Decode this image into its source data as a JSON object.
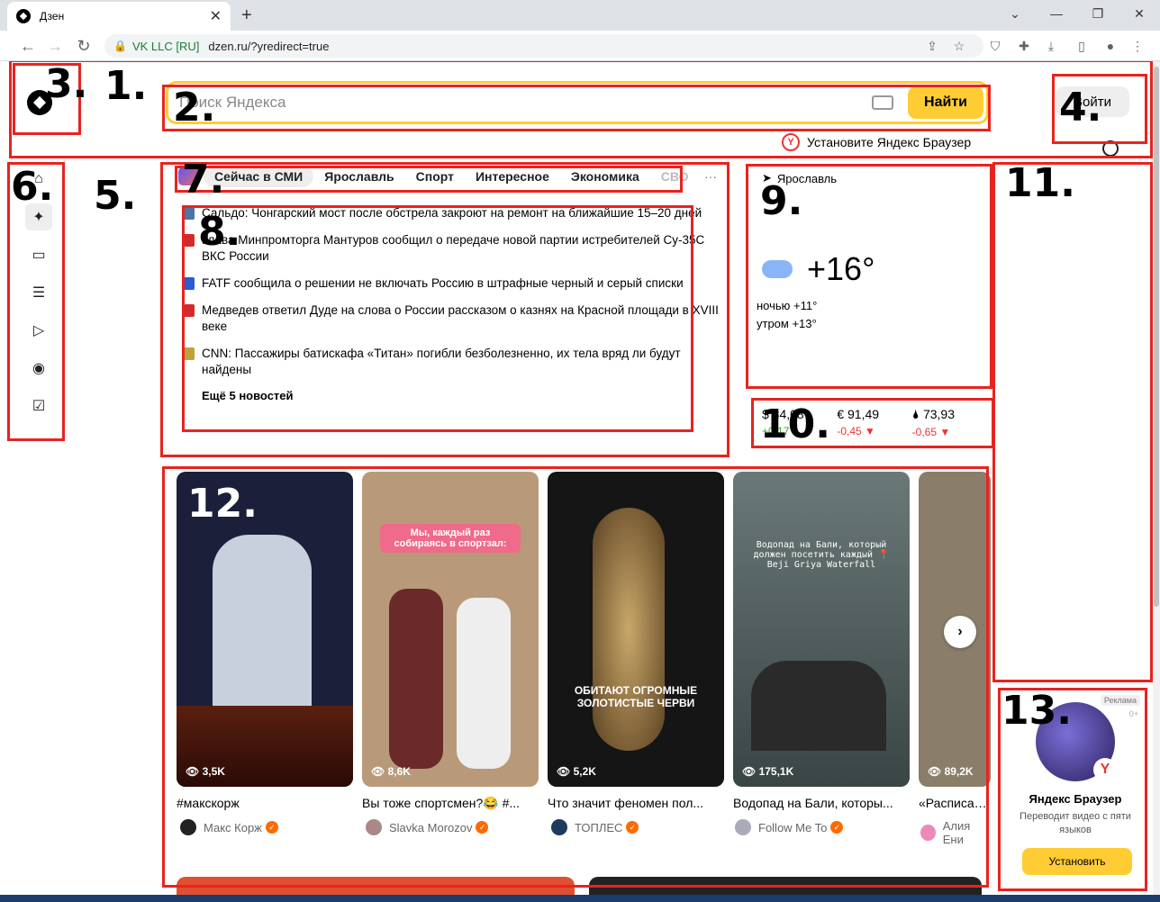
{
  "browser": {
    "tab_title": "Дзен",
    "new_tab": "+",
    "tab_close": "✕",
    "org": "VK LLC [RU]",
    "url": "dzen.ru/?yredirect=true"
  },
  "header": {
    "search_placeholder": "Поиск Яндекса",
    "find_label": "Найти",
    "login_label": "Войти",
    "promo_text": "Установите Яндекс Браузер"
  },
  "news": {
    "tabs": [
      "Сейчас в СМИ",
      "Ярославль",
      "Спорт",
      "Интересное",
      "Экономика",
      "СВО"
    ],
    "items": [
      {
        "text": "Сальдо: Чонгарский мост после обстрела закроют на ремонт на ближайшие 15–20 дней",
        "src_color": "#4a76a8"
      },
      {
        "text": "Глава Минпромторга Мантуров сообщил о передаче новой партии истребителей Су-35С ВКС России",
        "src_color": "#d42a2a"
      },
      {
        "text": "FATF сообщила о решении не включать Россию в штрафные черный и серый списки",
        "src_color": "#2a5bd4"
      },
      {
        "text": "Медведев ответил Дуде на слова о России рассказом о казнях на Красной площади в XVIII веке",
        "src_color": "#d42a2a"
      },
      {
        "text": "CNN: Пассажиры батискафа «Титан» погибли безболезненно, их тела вряд ли будут найдены",
        "src_color": "#bfa33a"
      }
    ],
    "more": "Ещё 5 новостей"
  },
  "weather": {
    "city": "Ярославль",
    "temp": "+16°",
    "night": "ночью +11°",
    "morning": "утром +13°"
  },
  "rates": [
    {
      "label": "$ 84,08",
      "delta": "+0,17"
    },
    {
      "label": "€ 91,49",
      "delta": "-0,45 ▼"
    },
    {
      "label": "🌢 73,93",
      "delta": "-0,65 ▼"
    }
  ],
  "videos": [
    {
      "title": "#макскорж",
      "views": "👁 3,5K",
      "bg": "#1b1f3a",
      "overlay": ""
    },
    {
      "title": "Вы тоже спортсмен?😂 #...",
      "views": "👁 8,6K",
      "bg": "#b89a7a",
      "overlay": "Мы, каждый раз собираясь в спортзал:"
    },
    {
      "title": "Что значит феномен пол...",
      "views": "👁 5,2K",
      "bg": "#151515",
      "overlay": "ОБИТАЮТ ОГРОМНЫЕ ЗОЛОТИСТЫЕ ЧЕРВИ"
    },
    {
      "title": "Водопад на Бали, которы...",
      "views": "👁 175,1K",
      "bg": "#5e6b6a",
      "overlay": "Водопад на Бали, который должен посетить каждый 📍 Beji Griya Waterfall"
    },
    {
      "title": "«Расписал...",
      "views": "👁 89,2K",
      "bg": "#8a7e6a",
      "overlay": ""
    }
  ],
  "authors": [
    {
      "name": "Макс Корж",
      "color": "#222"
    },
    {
      "name": "Slavka Morozov",
      "color": "#a88"
    },
    {
      "name": "ТОПЛЕС",
      "color": "#1e3a5f"
    },
    {
      "name": "Follow Me To",
      "color": "#aab"
    },
    {
      "name": "Алия Ени",
      "color": "#e8b"
    }
  ],
  "ad": {
    "label": "Реклама",
    "age": "0+",
    "title": "Яндекс Браузер",
    "subtitle": "Переводит видео с пяти языков",
    "button": "Установить"
  },
  "annotations": [
    "1.",
    "2.",
    "3.",
    "4.",
    "5.",
    "6.",
    "7.",
    "8.",
    "9.",
    "10.",
    "11.",
    "12.",
    "13."
  ]
}
